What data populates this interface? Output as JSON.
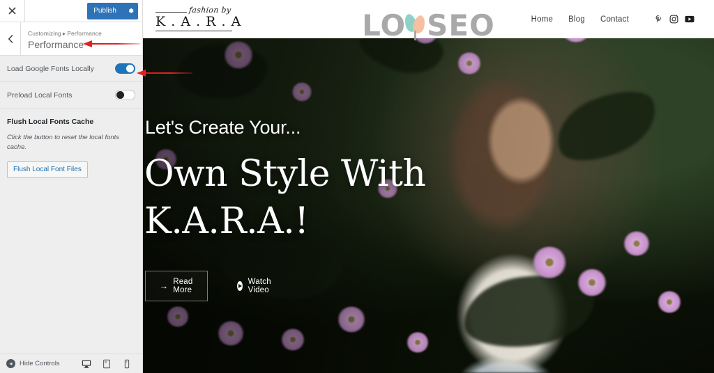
{
  "customizer": {
    "close_icon": "close-icon",
    "publish_label": "Publish",
    "gear_icon": "gear-icon",
    "back_icon": "chevron-left-icon",
    "breadcrumb": {
      "root": "Customizing",
      "separator": "▸",
      "current": "Performance"
    },
    "panel_title": "Performance",
    "controls": [
      {
        "label": "Load Google Fonts Locally",
        "state": "on"
      },
      {
        "label": "Preload Local Fonts",
        "state": "off"
      }
    ],
    "section": {
      "heading": "Flush Local Fonts Cache",
      "description": "Click the button to reset the local fonts cache.",
      "button_label": "Flush Local Font Files"
    },
    "footer": {
      "hide_controls_label": "Hide Controls",
      "devices": [
        {
          "name": "desktop",
          "active": true
        },
        {
          "name": "tablet",
          "active": false
        },
        {
          "name": "mobile",
          "active": false
        }
      ]
    },
    "colors": {
      "publish_blue": "#2e73b8",
      "toggle_on": "#1f73b7",
      "button_text": "#2271b1",
      "panel_bg": "#eeeeee"
    }
  },
  "annotations": [
    {
      "name": "arrow-to-panel-title",
      "color": "#e02222"
    },
    {
      "name": "arrow-to-toggle",
      "color": "#e02222"
    }
  ],
  "site": {
    "brand": {
      "script": "fashion by",
      "name": "K . A . R . A"
    },
    "nav": [
      {
        "label": "Home"
      },
      {
        "label": "Blog"
      },
      {
        "label": "Contact"
      }
    ],
    "social": [
      {
        "name": "pinterest-icon",
        "glyph": "P"
      },
      {
        "name": "instagram-icon",
        "glyph": "IG"
      },
      {
        "name": "youtube-icon",
        "glyph": "YT"
      }
    ],
    "watermark": {
      "before": "LO",
      "after": "SEO",
      "petal_left_color": "#7ecbc0",
      "petal_right_color": "#f5b894",
      "text_color": "#9e9e9e"
    },
    "hero": {
      "kicker": "Let's Create Your...",
      "title_line1": "Own Style With",
      "title_line2": "K.A.R.A.!",
      "primary_button": "Read More",
      "primary_button_icon": "arrow-right-icon",
      "secondary_button": "Watch Video",
      "secondary_button_icon": "play-circle-icon"
    }
  }
}
